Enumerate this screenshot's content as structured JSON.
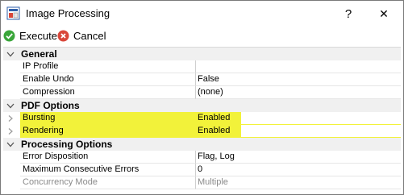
{
  "window": {
    "title": "Image Processing",
    "help_glyph": "?",
    "close_glyph": "✕"
  },
  "toolbar": {
    "execute_label": "Execute",
    "cancel_label": "Cancel"
  },
  "categories": {
    "general": {
      "label": "General",
      "rows": [
        {
          "name": "IP Profile",
          "value": ""
        },
        {
          "name": "Enable Undo",
          "value": "False"
        },
        {
          "name": "Compression",
          "value": "(none)"
        }
      ]
    },
    "pdf": {
      "label": "PDF Options",
      "rows": [
        {
          "name": "Bursting",
          "value": "Enabled"
        },
        {
          "name": "Rendering",
          "value": "Enabled"
        }
      ]
    },
    "processing": {
      "label": "Processing Options",
      "rows": [
        {
          "name": "Error Disposition",
          "value": "Flag, Log"
        },
        {
          "name": "Maximum Consecutive Errors",
          "value": "0"
        },
        {
          "name": "Concurrency Mode",
          "value": "Multiple"
        }
      ]
    }
  },
  "colors": {
    "highlight": "#f2f23a",
    "category_bg": "#f0f0f0",
    "execute_green": "#3aa63a",
    "cancel_red": "#d9473a"
  },
  "icons": {
    "app": "image-processing-icon",
    "execute": "check-circle-icon",
    "cancel": "x-circle-icon",
    "collapse": "collapse-arrow-icon",
    "expand": "expand-chevron-icon"
  }
}
